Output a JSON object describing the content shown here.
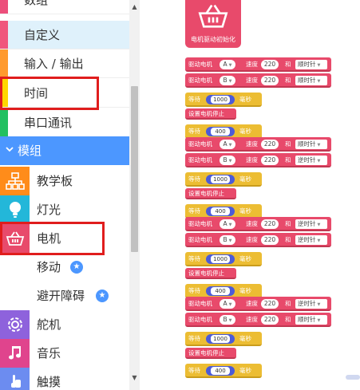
{
  "categories": [
    {
      "label": "数组",
      "color": "#ec4f7b"
    },
    {
      "label": "自定义",
      "color": "#f0567c"
    },
    {
      "label": "输入 / 输出",
      "color": "#ff9a2e"
    },
    {
      "label": "时间",
      "color": "#ffd600"
    },
    {
      "label": "串口通讯",
      "color": "#22c061"
    }
  ],
  "section": {
    "label": "模组"
  },
  "modules": [
    {
      "label": "教学板",
      "color": "#ff8c1a",
      "icon": "flowchart-icon"
    },
    {
      "label": "灯光",
      "color": "#23b7d9",
      "icon": "bulb-icon"
    },
    {
      "label": "电机",
      "color": "#e84a6b",
      "icon": "basket-icon"
    },
    {
      "label": "移动",
      "badge": "★"
    },
    {
      "label": "避开障碍",
      "badge": "★"
    },
    {
      "label": "舵机",
      "color": "#8e62dc",
      "icon": "gear-icon"
    },
    {
      "label": "音乐",
      "color": "#e0448d",
      "icon": "music-icon"
    },
    {
      "label": "触摸",
      "color": "#6c8cf0",
      "icon": "hand-icon"
    }
  ],
  "scrollbar": {
    "up": "▲",
    "down": "▼"
  },
  "workspace": {
    "hat_label": "电机驱动初始化",
    "motor_text": "驱动电机",
    "speed_text": "速度",
    "and_text": "和",
    "wait_text": "等待",
    "ms_text": "毫秒",
    "stop_text": "设置电机停止",
    "groups": [
      {
        "motors": [
          {
            "port": "A",
            "speed": "220",
            "dir": "顺时针"
          },
          {
            "port": "B",
            "speed": "220",
            "dir": "顺时针"
          }
        ],
        "wait1": "1000",
        "wait2": "400"
      },
      {
        "motors": [
          {
            "port": "A",
            "speed": "220",
            "dir": "顺时针"
          },
          {
            "port": "B",
            "speed": "220",
            "dir": "逆时针"
          }
        ],
        "wait1": "1000",
        "wait2": "400"
      },
      {
        "motors": [
          {
            "port": "A",
            "speed": "220",
            "dir": "逆时针"
          },
          {
            "port": "B",
            "speed": "220",
            "dir": "逆时针"
          }
        ],
        "wait1": "1000",
        "wait2": "400"
      },
      {
        "motors": [
          {
            "port": "A",
            "speed": "220",
            "dir": "逆时针"
          },
          {
            "port": "B",
            "speed": "220",
            "dir": "顺时针"
          }
        ],
        "wait1": "1000",
        "wait2": "400"
      }
    ]
  }
}
